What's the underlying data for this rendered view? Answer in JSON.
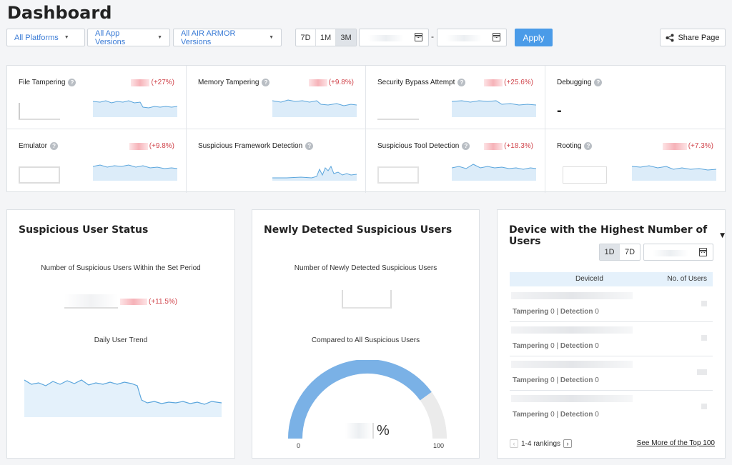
{
  "page_title": "Dashboard",
  "filters": [
    {
      "label": "All Platforms"
    },
    {
      "label": "All App Versions"
    },
    {
      "label": "All AIR ARMOR Versions"
    }
  ],
  "range_buttons": [
    "7D",
    "1M",
    "3M"
  ],
  "active_range": "3M",
  "date_separator": "-",
  "apply_label": "Apply",
  "share_label": "Share Page",
  "metrics": [
    {
      "label": "File Tampering",
      "change": "(+27%)"
    },
    {
      "label": "Memory Tampering",
      "change": "(+9.8%)"
    },
    {
      "label": "Security Bypass Attempt",
      "change": "(+25.6%)"
    },
    {
      "label": "Debugging",
      "value": "-"
    },
    {
      "label": "Emulator",
      "change": "(+9.8%)"
    },
    {
      "label": "Suspicious Framework Detection",
      "change": ""
    },
    {
      "label": "Suspicious Tool Detection",
      "change": "(+18.3%)"
    },
    {
      "label": "Rooting",
      "change": "(+7.3%)"
    }
  ],
  "suspicious_user_status": {
    "title": "Suspicious User Status",
    "period_label": "Number of Suspicious Users Within the Set Period",
    "change": "(+11.5%)",
    "trend_label": "Daily User Trend"
  },
  "newly_detected": {
    "title": "Newly Detected Suspicious Users",
    "count_label": "Number of Newly Detected Suspicious Users",
    "compare_label": "Compared to All Suspicious Users",
    "percent_sign": "%",
    "gauge_min": "0",
    "gauge_max": "100",
    "gauge_fill": 0.8
  },
  "device_top": {
    "title": "Device with the Highest Number of Users",
    "range_buttons": [
      "1D",
      "7D"
    ],
    "active_range": "1D",
    "col_device": "DeviceId",
    "col_users": "No. of Users",
    "rows": [
      {
        "tampering_label": "Tampering",
        "tampering": "0",
        "sep": "|",
        "detection_label": "Detection",
        "detection": "0"
      },
      {
        "tampering_label": "Tampering",
        "tampering": "0",
        "sep": "|",
        "detection_label": "Detection",
        "detection": "0"
      },
      {
        "tampering_label": "Tampering",
        "tampering": "0",
        "sep": "|",
        "detection_label": "Detection",
        "detection": "0"
      },
      {
        "tampering_label": "Tampering",
        "tampering": "0",
        "sep": "|",
        "detection_label": "Detection",
        "detection": "0"
      }
    ],
    "rankings": "1-4 rankings",
    "see_more": "See More of the Top 100"
  }
}
